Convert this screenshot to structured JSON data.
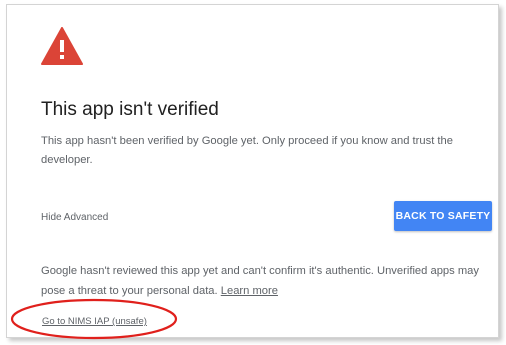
{
  "dialog": {
    "title": "This app isn't verified",
    "description": "This app hasn't been verified by Google yet. Only proceed if you know and trust the developer.",
    "hide_advanced_label": "Hide Advanced",
    "back_to_safety_label": "BACK TO SAFETY",
    "warning_text": "Google hasn't reviewed this app yet and can't confirm it's authentic. Unverified apps may pose a threat to your personal data.",
    "learn_more_label": "Learn more",
    "proceed_link_label": "Go to NIMS IAP (unsafe)",
    "warning_icon": "warning-triangle-icon"
  },
  "colors": {
    "warning_red": "#db4437",
    "primary_blue": "#4285f4",
    "annotation_red": "#e0201c"
  }
}
